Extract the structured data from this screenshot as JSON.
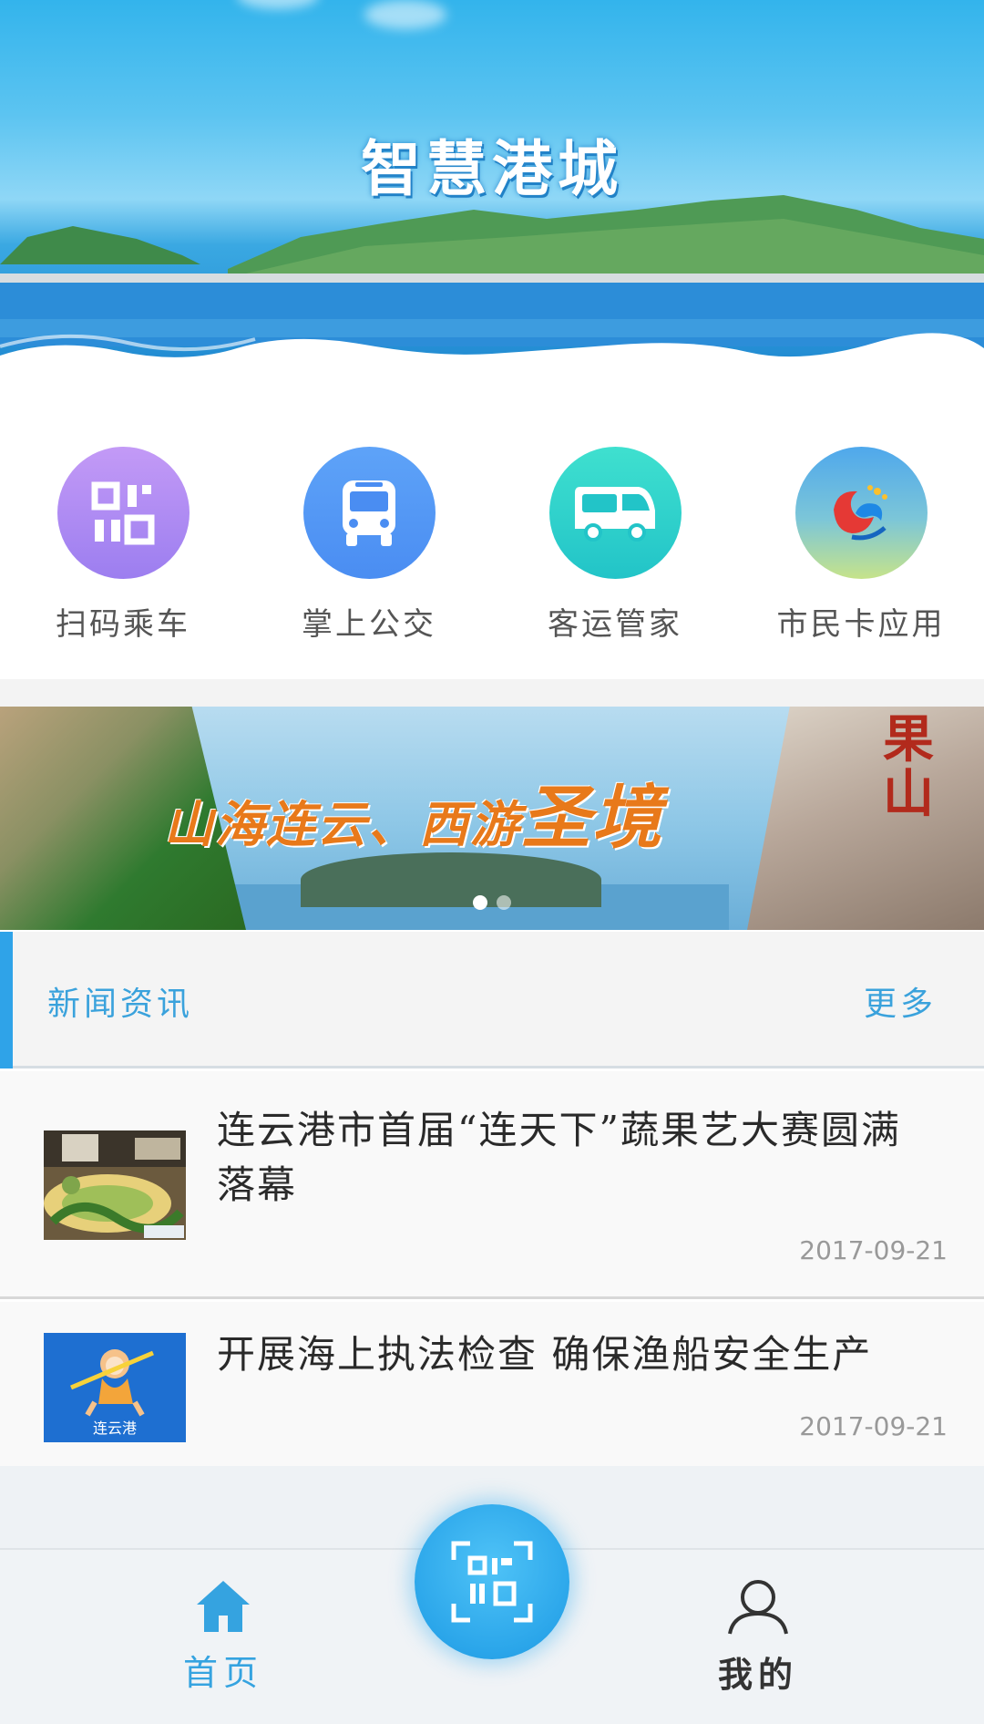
{
  "hero": {
    "title": "智慧港城"
  },
  "quick_actions": [
    {
      "label": "扫码乘车",
      "icon": "qr-code-icon",
      "color_top": "#c39af6",
      "color_bottom": "#9c7ef0"
    },
    {
      "label": "掌上公交",
      "icon": "bus-icon",
      "color_top": "#5ea3f8",
      "color_bottom": "#4a8df2"
    },
    {
      "label": "客运管家",
      "icon": "coach-bus-icon",
      "color_top": "#3fe0cf",
      "color_bottom": "#22c4c8"
    },
    {
      "label": "市民卡应用",
      "icon": "citizen-card-logo-icon",
      "color_top": "#4fa8ec",
      "color_bottom": "#b8e48c"
    }
  ],
  "promo_banner": {
    "title_part1": "山海连云、西游",
    "title_part2": "圣境",
    "seal_text": "果山",
    "slides": 2,
    "active_slide": 1
  },
  "news": {
    "section_title": "新闻资讯",
    "more_label": "更多",
    "items": [
      {
        "headline": "连云港市首届“连天下”蔬果艺大赛圆满落幕",
        "date": "2017-09-21",
        "thumb": "fruit-art-photo"
      },
      {
        "headline": "开展海上执法检查 确保渔船安全生产",
        "date": "2017-09-21",
        "thumb": "lianyungang-mascot",
        "thumb_caption": "连云港"
      }
    ]
  },
  "bottom_nav": {
    "home_label": "首页",
    "mine_label": "我的",
    "accent_color": "#35a3e0"
  }
}
